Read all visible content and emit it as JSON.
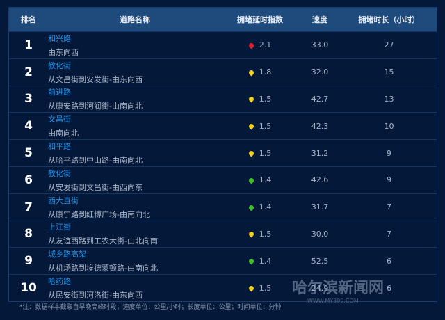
{
  "headers": {
    "rank": "排名",
    "road": "道路名称",
    "index": "拥堵延时指数",
    "speed": "速度",
    "duration": "拥堵时长（小时）"
  },
  "colors": {
    "red": "#e0202a",
    "yellow": "#f2d21c",
    "green": "#3fbf2a"
  },
  "rows": [
    {
      "rank": "1",
      "name": "和兴路",
      "dir": "由东向西",
      "index": "2.1",
      "pin": "red",
      "speed": "33.0",
      "duration": "27"
    },
    {
      "rank": "2",
      "name": "教化街",
      "dir": "从文昌街到安发街-由东向西",
      "index": "1.8",
      "pin": "yellow",
      "speed": "32.0",
      "duration": "15"
    },
    {
      "rank": "3",
      "name": "前进路",
      "dir": "从康安路到河润街-由南向北",
      "index": "1.5",
      "pin": "yellow",
      "speed": "42.7",
      "duration": "13"
    },
    {
      "rank": "4",
      "name": "文昌街",
      "dir": "由南向北",
      "index": "1.5",
      "pin": "yellow",
      "speed": "42.3",
      "duration": "10"
    },
    {
      "rank": "5",
      "name": "和平路",
      "dir": "从哈平路到中山路-由南向北",
      "index": "1.5",
      "pin": "yellow",
      "speed": "31.2",
      "duration": "9"
    },
    {
      "rank": "6",
      "name": "教化街",
      "dir": "从安发街到文昌街-由西向东",
      "index": "1.4",
      "pin": "green",
      "speed": "42.6",
      "duration": "9"
    },
    {
      "rank": "7",
      "name": "西大直街",
      "dir": "从康宁路到红博广场-由南向北",
      "index": "1.4",
      "pin": "green",
      "speed": "31.7",
      "duration": "7"
    },
    {
      "rank": "8",
      "name": "上江街",
      "dir": "从友谊西路到工农大街-由北向南",
      "index": "1.5",
      "pin": "yellow",
      "speed": "30.0",
      "duration": "7"
    },
    {
      "rank": "9",
      "name": "城乡路高架",
      "dir": "从机场路到埃德蒙顿路-由南向北",
      "index": "1.4",
      "pin": "green",
      "speed": "52.5",
      "duration": "6"
    },
    {
      "rank": "10",
      "name": "哈药路",
      "dir": "从民安街到河洛街-由东向西",
      "index": "1.5",
      "pin": "yellow",
      "speed": "24.9",
      "duration": "6"
    }
  ],
  "note": "*注：数据样本截取自早晚高峰时段；速度单位：公里/小时；长度单位：公里；时间单位：分钟",
  "watermark": {
    "logo": "哈尔滨新闻网",
    "url": "WWW.MY399.COM"
  }
}
